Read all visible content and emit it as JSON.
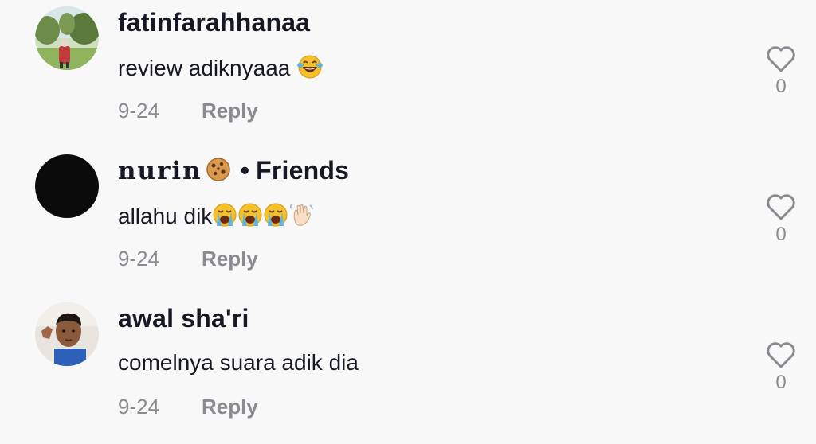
{
  "comments": [
    {
      "username": "fatinfarahhanaa",
      "text": "review adiknyaaa",
      "date": "9-24",
      "reply_label": "Reply",
      "likes": "0",
      "text_emojis": [
        "laughing-tears-emoji"
      ]
    },
    {
      "username": "nurin",
      "username_suffix": "Friends",
      "text": "allahu dik",
      "date": "9-24",
      "reply_label": "Reply",
      "likes": "0",
      "username_emojis": [
        "cookie-emoji"
      ],
      "text_emojis": [
        "loudly-crying-emoji",
        "loudly-crying-emoji",
        "loudly-crying-emoji",
        "waving-hand-emoji"
      ]
    },
    {
      "username": "awal sha'ri",
      "text": "comelnya suara adik dia",
      "date": "9-24",
      "reply_label": "Reply",
      "likes": "0"
    }
  ],
  "colors": {
    "background": "#f8f8f8",
    "primary_text": "#161823",
    "secondary_text": "#8a8b91"
  }
}
